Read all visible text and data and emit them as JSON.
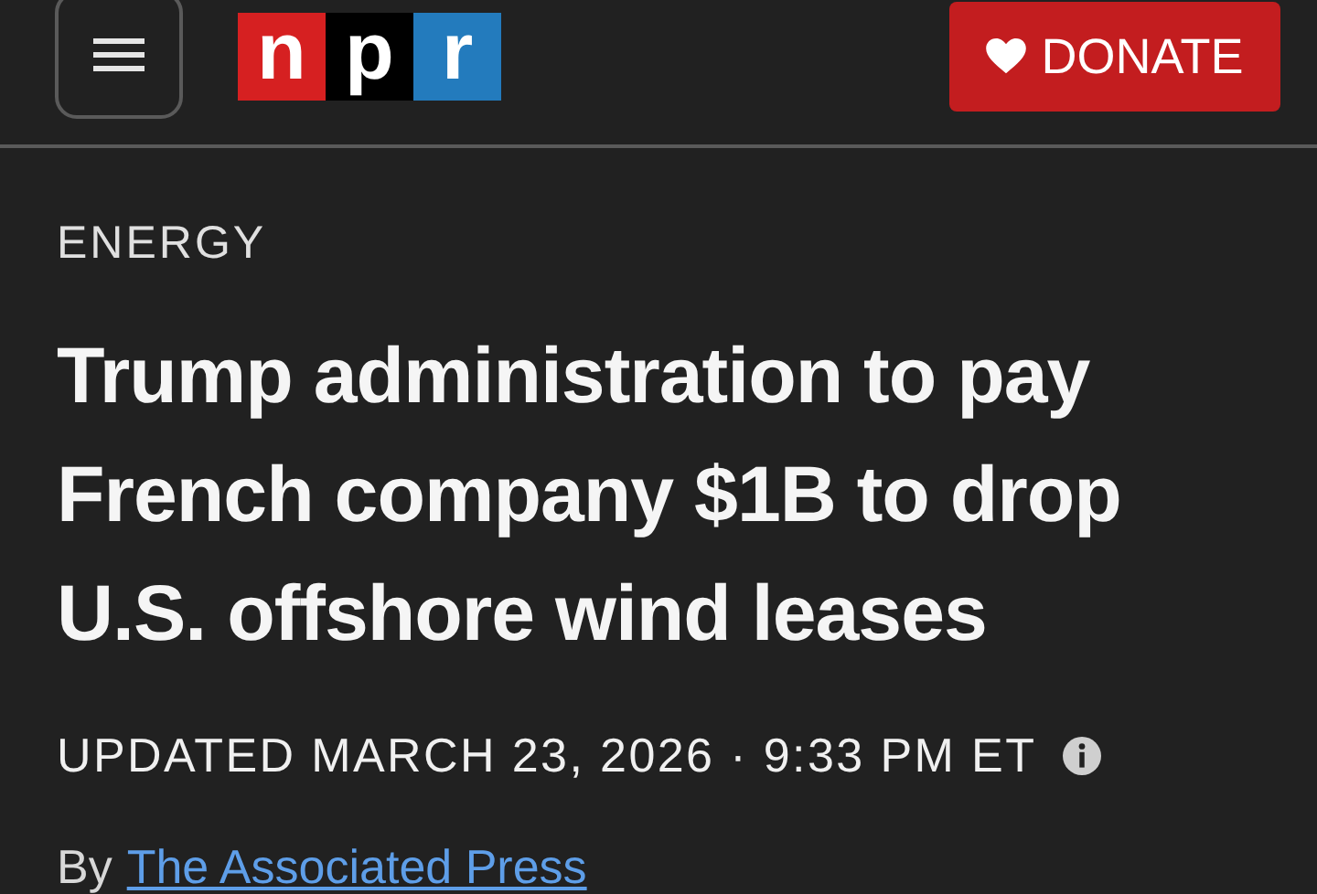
{
  "header": {
    "logo": [
      "n",
      "p",
      "r"
    ],
    "donate_label": "DONATE"
  },
  "article": {
    "section": "ENERGY",
    "headline": "Trump administration to pay French company $1B to drop U.S. offshore wind leases",
    "updated": "UPDATED MARCH 23, 2026 · 9:33 PM ET",
    "byline_prefix": "By",
    "author": "The Associated Press"
  }
}
